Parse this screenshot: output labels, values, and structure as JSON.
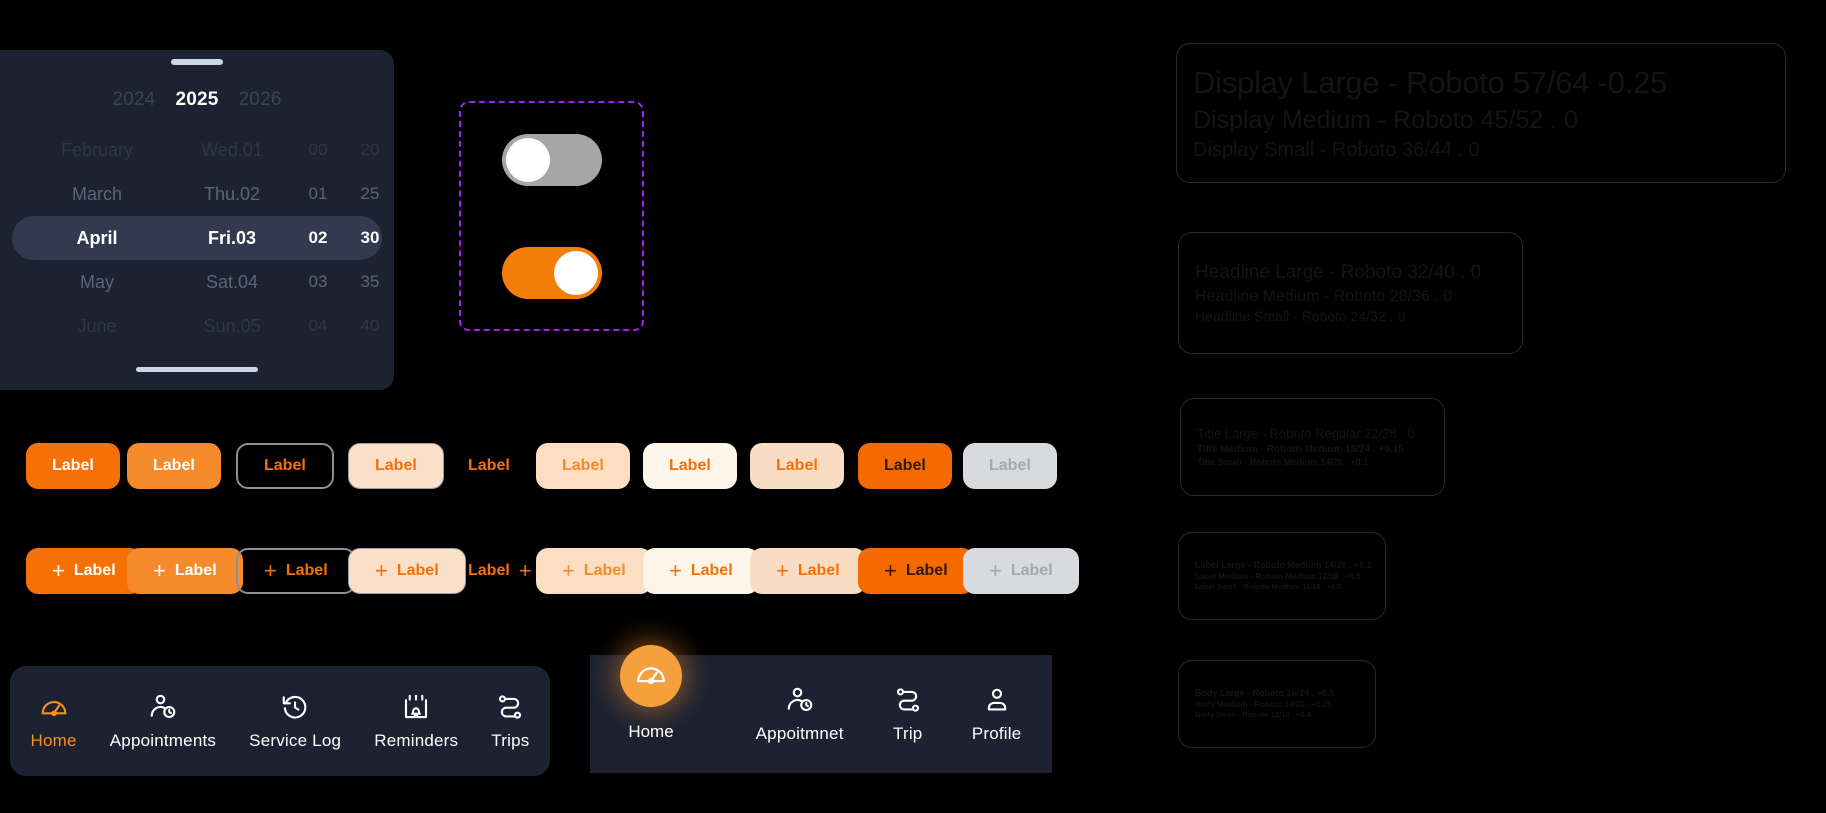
{
  "date_picker": {
    "grabber": "drag-handle",
    "years": [
      {
        "label": "2024",
        "selected": false
      },
      {
        "label": "2025",
        "selected": true
      },
      {
        "label": "2026",
        "selected": false
      }
    ],
    "rows": [
      {
        "month": "February",
        "day": "Wed.01",
        "hour": "00",
        "minute": "20",
        "selected": false
      },
      {
        "month": "March",
        "day": "Thu.02",
        "hour": "01",
        "minute": "25",
        "selected": false
      },
      {
        "month": "April",
        "day": "Fri.03",
        "hour": "02",
        "minute": "30",
        "selected": true
      },
      {
        "month": "May",
        "day": "Sat.04",
        "hour": "03",
        "minute": "35",
        "selected": false
      },
      {
        "month": "June",
        "day": "Sun.05",
        "hour": "04",
        "minute": "40",
        "selected": false
      }
    ]
  },
  "toggles": {
    "selection_border_color": "#a021f0",
    "items": [
      {
        "state": "off",
        "track_color": "#a6a6a6",
        "knob_color": "#ffffff"
      },
      {
        "state": "on",
        "track_color": "#f57d0a",
        "knob_color": "#ffffff"
      }
    ]
  },
  "buttons": {
    "label": "Label",
    "plus_icon": "+",
    "row1": [
      {
        "variant": "filled",
        "label": "Label"
      },
      {
        "variant": "filled-soft",
        "label": "Label"
      },
      {
        "variant": "outlined",
        "label": "Label"
      },
      {
        "variant": "tonal",
        "label": "Label"
      },
      {
        "variant": "text",
        "label": "Label"
      },
      {
        "variant": "tonal2",
        "label": "Label"
      },
      {
        "variant": "white",
        "label": "Label"
      },
      {
        "variant": "tonal3",
        "label": "Label"
      },
      {
        "variant": "strong",
        "label": "Label"
      },
      {
        "variant": "disabled",
        "label": "Label"
      }
    ],
    "row2": [
      {
        "variant": "filled",
        "label": "Label",
        "icon": "+",
        "icon_position": "leading"
      },
      {
        "variant": "filled-soft",
        "label": "Label",
        "icon": "+",
        "icon_position": "leading"
      },
      {
        "variant": "outlined",
        "label": "Label",
        "icon": "+",
        "icon_position": "leading"
      },
      {
        "variant": "tonal",
        "label": "Label",
        "icon": "+",
        "icon_position": "leading"
      },
      {
        "variant": "text",
        "label": "Label",
        "icon": "+",
        "icon_position": "trailing"
      },
      {
        "variant": "tonal2",
        "label": "Label",
        "icon": "+",
        "icon_position": "leading"
      },
      {
        "variant": "white",
        "label": "Label",
        "icon": "+",
        "icon_position": "leading"
      },
      {
        "variant": "tonal3",
        "label": "Label",
        "icon": "+",
        "icon_position": "leading"
      },
      {
        "variant": "strong",
        "label": "Label",
        "icon": "+",
        "icon_position": "leading"
      },
      {
        "variant": "disabled",
        "label": "Label",
        "icon": "+",
        "icon_position": "leading"
      }
    ]
  },
  "nav_left": {
    "items": [
      {
        "label": "Home",
        "icon": "speedometer-icon",
        "active": true
      },
      {
        "label": "Appointments",
        "icon": "person-clock-icon",
        "active": false
      },
      {
        "label": "Service Log",
        "icon": "clock-rewind-icon",
        "active": false
      },
      {
        "label": "Reminders",
        "icon": "calendar-bell-icon",
        "active": false
      },
      {
        "label": "Trips",
        "icon": "route-icon",
        "active": false
      }
    ]
  },
  "nav_right": {
    "fab": {
      "label": "Home",
      "icon": "speedometer-icon",
      "color": "#f5a03c"
    },
    "items": [
      {
        "label": "Appoitmnet",
        "icon": "person-clock-icon",
        "active": false
      },
      {
        "label": "Trip",
        "icon": "route-icon",
        "active": false
      },
      {
        "label": "Profile",
        "icon": "person-icon",
        "active": false
      }
    ]
  },
  "typography": {
    "display": [
      "Display Large - Roboto 57/64 -0.25",
      "Display Medium - Roboto 45/52 .  0",
      "Display Small - Roboto 36/44 . 0"
    ],
    "headline": [
      "Headline Large - Roboto 32/40 . 0",
      "Headline Medium - Roboto 28/36 . 0",
      "Headline Small - Roboto 24/32 . 0"
    ],
    "title": [
      "Title Large - Roboto Regular 22/28 . 0",
      "Title Medium - Roboto Medium 16/24 . +0.15",
      "Title Small - Roboto Medium 14/20 . +0.1"
    ],
    "label": [
      "Label Large - Roboto Medium 14/20 . +0.1",
      "Label Medium - Roboto Medium 12/16 . +0.5",
      "Label Small - Roboto Medium 11/16 . +0.5"
    ],
    "body": [
      "Body Large - Roboto 16/24 . +0.5",
      "Body Medium - Roboto 14/20 . +0.25",
      "Body Small - Roboto 12/16 . +0.4"
    ]
  },
  "colors": {
    "accent_orange": "#f57105",
    "panel_dark": "#1c2231",
    "selection_purple": "#a021f0",
    "background": "#000000"
  }
}
